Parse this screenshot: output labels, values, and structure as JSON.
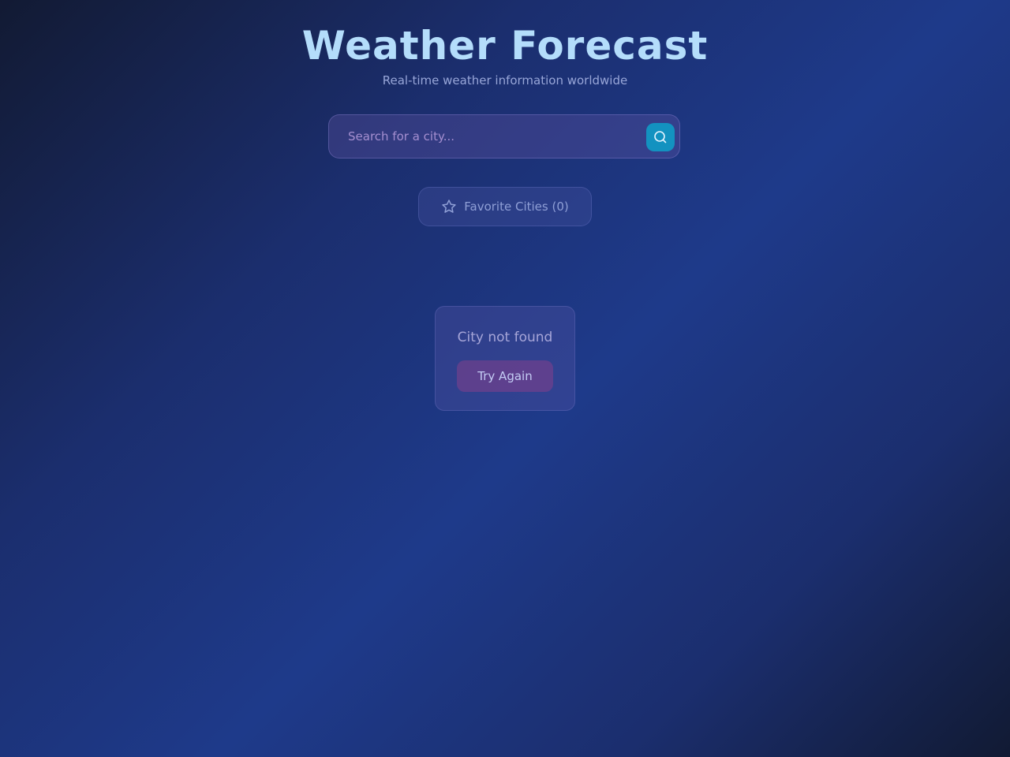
{
  "header": {
    "title": "Weather Forecast",
    "subtitle": "Real-time weather information worldwide"
  },
  "search": {
    "placeholder": "Search for a city...",
    "value": "",
    "button_icon": "search-icon"
  },
  "favorites": {
    "label": "Favorite Cities (0)",
    "icon": "star-icon"
  },
  "error": {
    "message": "City not found",
    "retry_label": "Try Again"
  },
  "colors": {
    "title": "#b4ddfb",
    "search_button": "#1392c0",
    "retry_button": "#84408c"
  }
}
